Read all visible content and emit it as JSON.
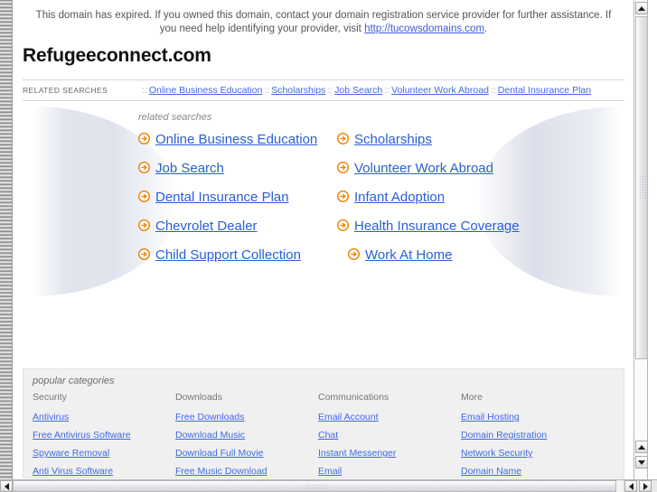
{
  "notice": {
    "text_before": "This domain has expired. If you owned this domain, contact your domain registration service provider for further assistance. If you need help identifying your provider, visit ",
    "link_text": "http://tucowsdomains.com",
    "text_after": "."
  },
  "domain_title": "Refugeeconnect.com",
  "related_searches_bar": {
    "label": "RELATED SEARCHES",
    "separator": "::",
    "links": [
      "Online Business Education",
      "Scholarships",
      "Job Search",
      "Volunteer Work Abroad",
      "Dental Insurance Plan"
    ]
  },
  "related_searches_block": {
    "caption": "related searches",
    "icon": "arrow-circle-icon",
    "rows": [
      {
        "left": "Online Business Education",
        "right": "Scholarships"
      },
      {
        "left": "Job Search",
        "right": "Volunteer Work Abroad"
      },
      {
        "left": "Dental Insurance Plan",
        "right": "Infant Adoption"
      },
      {
        "left": "Chevrolet Dealer",
        "right": "Health Insurance Coverage"
      },
      {
        "left": "Child Support Collection",
        "right": "Work At Home"
      }
    ]
  },
  "popular_categories": {
    "caption": "popular categories",
    "columns": [
      {
        "heading": "Security",
        "links": [
          "Antivirus",
          "Free Antivirus Software",
          "Spyware Removal",
          "Anti Virus Software"
        ]
      },
      {
        "heading": "Downloads",
        "links": [
          "Free Downloads",
          "Download Music",
          "Download Full Movie",
          "Free Music Download"
        ]
      },
      {
        "heading": "Communications",
        "links": [
          "Email Account",
          "Chat",
          "Instant Messenger",
          "Email"
        ]
      },
      {
        "heading": "More",
        "links": [
          "Email Hosting",
          "Domain Registration",
          "Network Security",
          "Domain Name"
        ]
      }
    ]
  },
  "colors": {
    "link_blue": "#4169e1",
    "big_link_blue": "#2a5fd4",
    "arrow_orange": "#ef8200",
    "panel_gray": "#f0f0f0",
    "caption_gray": "#8a8a8a"
  },
  "scrollbars": {
    "vertical_up_icon": "triangle-up-icon",
    "vertical_down_icon": "triangle-down-icon",
    "horizontal_left_icon": "triangle-left-icon",
    "horizontal_right_icon": "triangle-right-icon"
  }
}
